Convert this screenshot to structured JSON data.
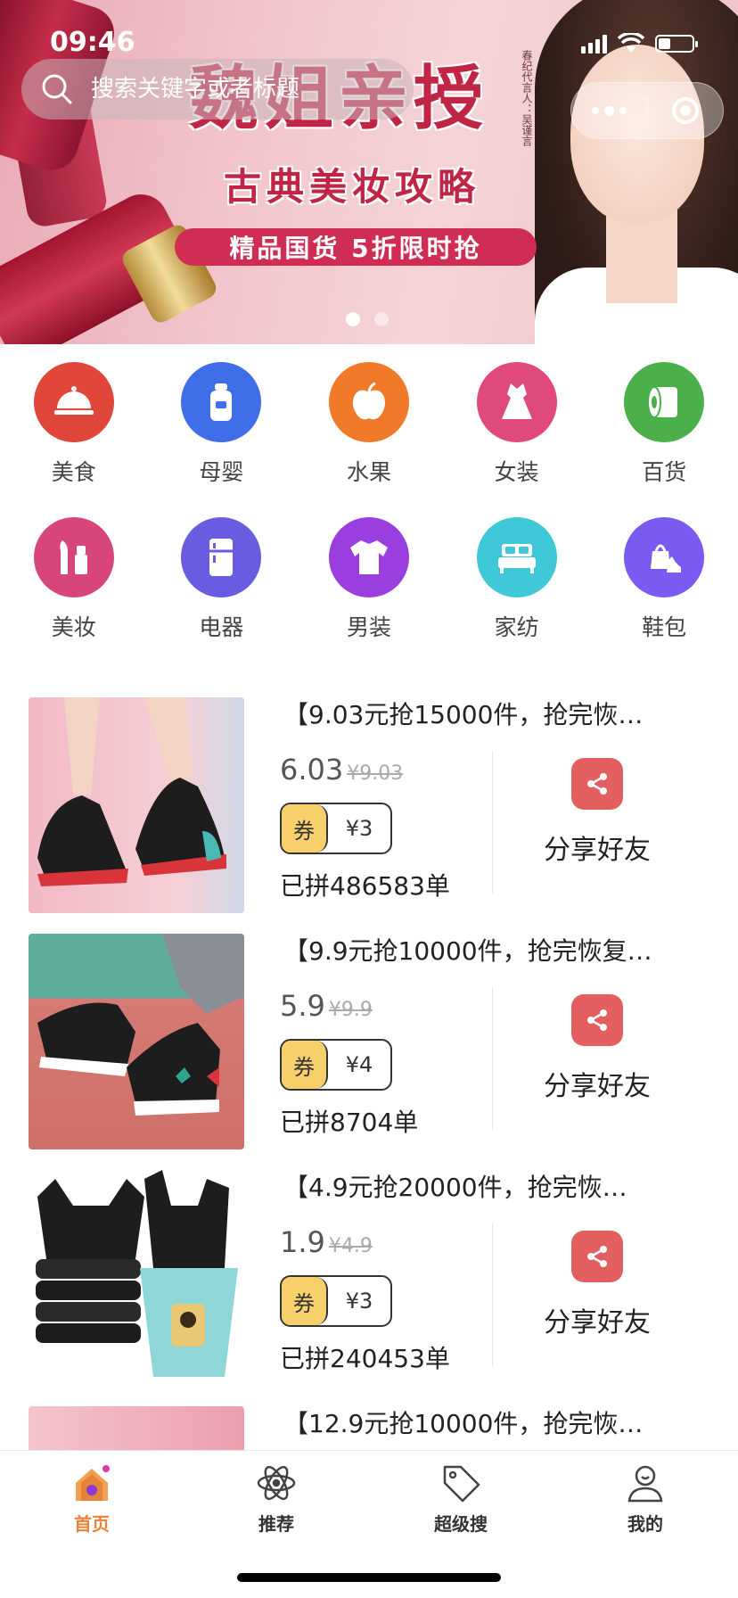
{
  "status_bar": {
    "time": "09:46",
    "battery_level": 0.35
  },
  "search": {
    "placeholder": "搜索关键字或者标题"
  },
  "banner": {
    "headline": "魏姐亲授",
    "subline": "古典美妆攻略",
    "promo": "精品国货 5折限时抢",
    "vertical_text": "春纪代言人：吴谨言",
    "slide_count": 2,
    "active_slide": 1
  },
  "categories": [
    {
      "label": "美食",
      "icon": "cloche-icon",
      "color": "#e0463a"
    },
    {
      "label": "母婴",
      "icon": "baby-bottle-icon",
      "color": "#3f6ee8"
    },
    {
      "label": "水果",
      "icon": "apple-icon",
      "color": "#f07a2a"
    },
    {
      "label": "女装",
      "icon": "dress-icon",
      "color": "#e04a7a"
    },
    {
      "label": "百货",
      "icon": "paper-roll-icon",
      "color": "#4cb04a"
    },
    {
      "label": "美妆",
      "icon": "makeup-brush-icon",
      "color": "#d8457a"
    },
    {
      "label": "电器",
      "icon": "fridge-icon",
      "color": "#6a5ce0"
    },
    {
      "label": "男装",
      "icon": "tshirt-icon",
      "color": "#9b3ee0"
    },
    {
      "label": "家纺",
      "icon": "bed-icon",
      "color": "#3ec8d8"
    },
    {
      "label": "鞋包",
      "icon": "heel-bag-icon",
      "color": "#7a5af0"
    }
  ],
  "products": [
    {
      "title": "【9.03元抢15000件，抢完恢…",
      "price": "6.03",
      "original_price": "¥9.03",
      "coupon_tag": "券",
      "coupon_value": "¥3",
      "sold": "已拼486583单",
      "share_label": "分享好友"
    },
    {
      "title": "【9.9元抢10000件，抢完恢复…",
      "price": "5.9",
      "original_price": "¥9.9",
      "coupon_tag": "券",
      "coupon_value": "¥4",
      "sold": "已拼8704单",
      "share_label": "分享好友"
    },
    {
      "title": "【4.9元抢20000件，抢完恢…",
      "price": "1.9",
      "original_price": "¥4.9",
      "coupon_tag": "券",
      "coupon_value": "¥3",
      "sold": "已拼240453单",
      "share_label": "分享好友"
    },
    {
      "title": "【12.9元抢10000件，抢完恢…"
    }
  ],
  "tabbar": {
    "active_color": "#e8843a",
    "tabs": [
      {
        "label": "首页",
        "icon": "home-icon",
        "active": true
      },
      {
        "label": "推荐",
        "icon": "atom-icon",
        "active": false
      },
      {
        "label": "超级搜",
        "icon": "tag-icon",
        "active": false
      },
      {
        "label": "我的",
        "icon": "user-icon",
        "active": false
      }
    ]
  }
}
